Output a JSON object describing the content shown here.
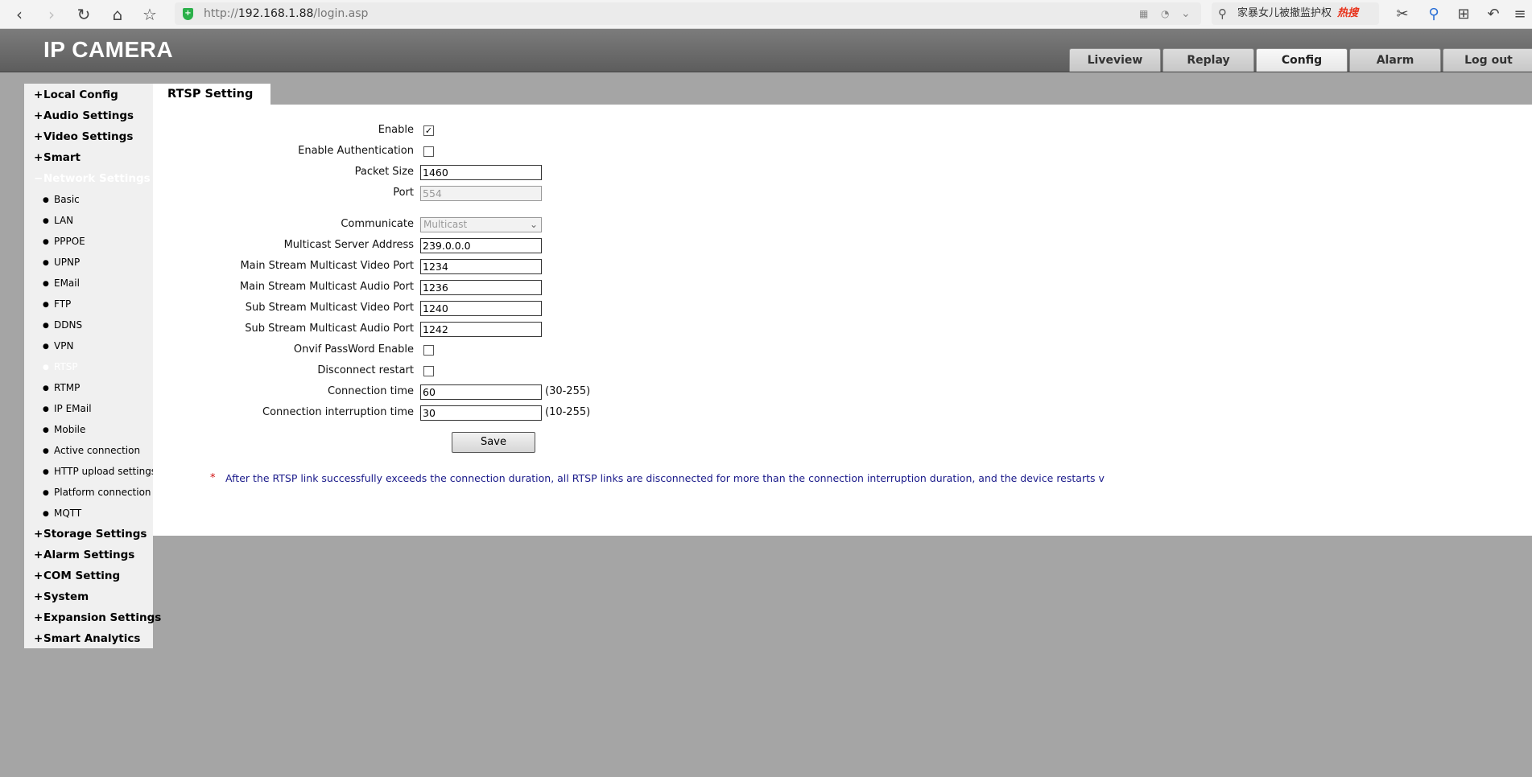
{
  "browser": {
    "url_prefix": "http://",
    "url_host": "192.168.1.88",
    "url_path": "/login.asp",
    "search_text": "家暴女儿被撤监护权",
    "hot_tag": "热搜"
  },
  "header": {
    "brand": "IP CAMERA",
    "tabs": [
      "Liveview",
      "Replay",
      "Config",
      "Alarm",
      "Log out"
    ],
    "active_tab": "Config"
  },
  "sidebar": {
    "groups_top": [
      {
        "sign": "+",
        "label": "Local Config"
      },
      {
        "sign": "+",
        "label": "Audio Settings"
      },
      {
        "sign": "+",
        "label": "Video Settings"
      },
      {
        "sign": "+",
        "label": "Smart"
      },
      {
        "sign": "−",
        "label": "Network Settings"
      }
    ],
    "network_items": [
      "Basic",
      "LAN",
      "PPPOE",
      "UPNP",
      "EMail",
      "FTP",
      "DDNS",
      "VPN",
      "RTSP",
      "RTMP",
      "IP EMail",
      "Mobile",
      "Active connection",
      "HTTP upload settings",
      "Platform connection",
      "MQTT"
    ],
    "groups_bottom": [
      {
        "sign": "+",
        "label": "Storage Settings"
      },
      {
        "sign": "+",
        "label": "Alarm Settings"
      },
      {
        "sign": "+",
        "label": "COM Setting"
      },
      {
        "sign": "+",
        "label": "System"
      },
      {
        "sign": "+",
        "label": "Expansion Settings"
      },
      {
        "sign": "+",
        "label": "Smart Analytics"
      }
    ]
  },
  "panel": {
    "title": "RTSP Setting",
    "enable_label": "Enable",
    "enable_checked": "✓",
    "auth_label": "Enable Authentication",
    "packet_size_label": "Packet Size",
    "packet_size": "1460",
    "port_label": "Port",
    "port": "554",
    "communicate_label": "Communicate",
    "communicate": "Multicast",
    "mcast_addr_label": "Multicast Server Address",
    "mcast_addr": "239.0.0.0",
    "main_video_label": "Main Stream Multicast Video Port",
    "main_video": "1234",
    "main_audio_label": "Main Stream Multicast Audio Port",
    "main_audio": "1236",
    "sub_video_label": "Sub Stream Multicast Video Port",
    "sub_video": "1240",
    "sub_audio_label": "Sub Stream Multicast Audio Port",
    "sub_audio": "1242",
    "onvif_label": "Onvif PassWord Enable",
    "disconnect_label": "Disconnect restart",
    "conn_time_label": "Connection time",
    "conn_time": "60",
    "conn_time_range": "(30-255)",
    "interrupt_label": "Connection interruption time",
    "interrupt_time": "30",
    "interrupt_range": "(10-255)",
    "save_label": "Save",
    "note_star": "*",
    "note": "After the RTSP link successfully exceeds the connection duration, all RTSP links are disconnected for more than the connection interruption duration, and the device restarts v"
  }
}
